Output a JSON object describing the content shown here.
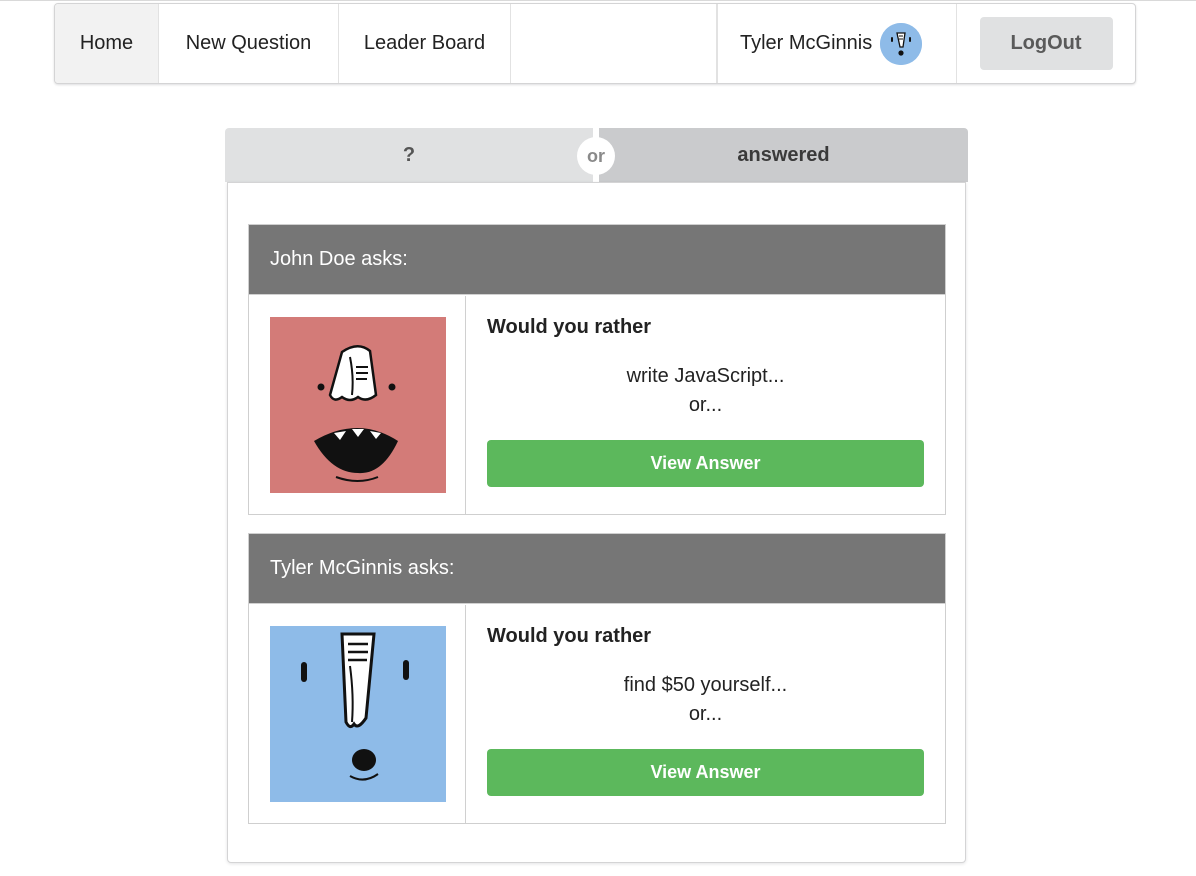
{
  "nav": {
    "home": "Home",
    "new_question": "New Question",
    "leader_board": "Leader Board",
    "user_name": "Tyler McGinnis",
    "logout": "LogOut"
  },
  "tabs": {
    "unanswered": "?",
    "or": "or",
    "answered": "answered"
  },
  "questions": [
    {
      "header": "John Doe asks:",
      "title": "Would you rather",
      "option": "write JavaScript...",
      "or": "or...",
      "button": "View Answer",
      "avatar_color": "#d37b78"
    },
    {
      "header": "Tyler McGinnis asks:",
      "title": "Would you rather",
      "option": "find $50 yourself...",
      "or": "or...",
      "button": "View Answer",
      "avatar_color": "#8ebbe8"
    }
  ],
  "colors": {
    "accent_button": "#5cb85c",
    "card_header": "#767676",
    "active_nav": "#f2f2f2"
  }
}
